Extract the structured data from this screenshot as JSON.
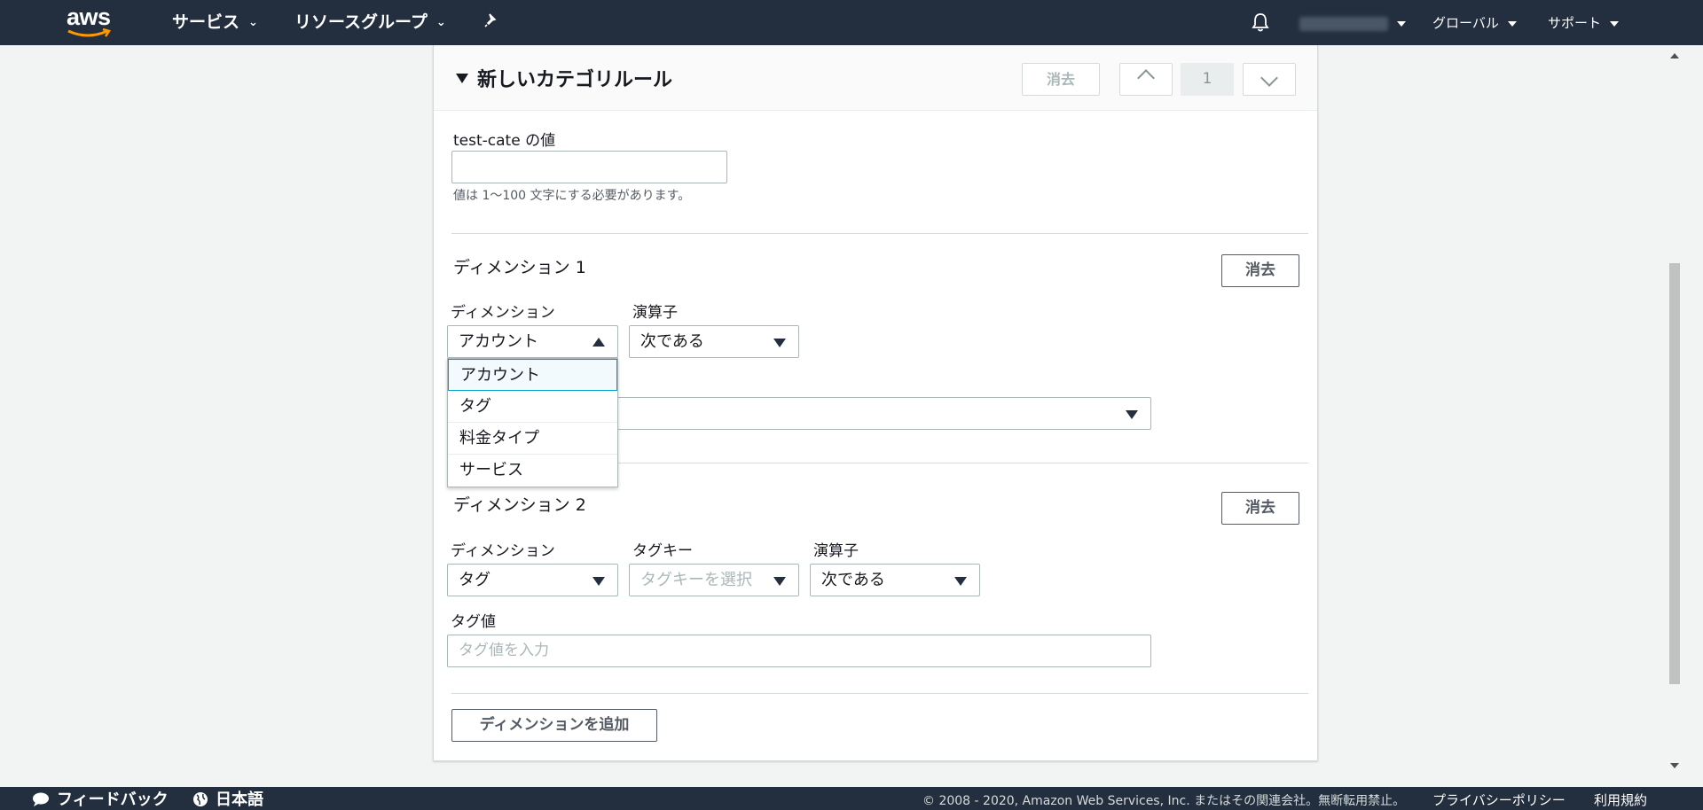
{
  "nav": {
    "logo": "aws",
    "services": "サービス",
    "resource_groups": "リソースグループ",
    "global": "グローバル",
    "support": "サポート"
  },
  "rule": {
    "title": "新しいカテゴリルール",
    "delete_label": "消去",
    "page_number": "1"
  },
  "value_field": {
    "label": "test-cate の値",
    "value": "",
    "hint": "値は 1〜100 文字にする必要があります。"
  },
  "dimension1": {
    "title": "ディメンション 1",
    "delete_label": "消去",
    "dimension_label": "ディメンション",
    "dimension_value": "アカウント",
    "operator_label": "演算子",
    "operator_value": "次である",
    "dropdown_options": [
      "アカウント",
      "タグ",
      "料金タイプ",
      "サービス"
    ]
  },
  "dimension2": {
    "title": "ディメンション 2",
    "delete_label": "消去",
    "dimension_label": "ディメンション",
    "dimension_value": "タグ",
    "tagkey_label": "タグキー",
    "tagkey_placeholder": "タグキーを選択",
    "operator_label": "演算子",
    "operator_value": "次である",
    "tagvalue_label": "タグ値",
    "tagvalue_placeholder": "タグ値を入力"
  },
  "add_dimension_label": "ディメンションを追加",
  "footer": {
    "feedback": "フィードバック",
    "language": "日本語",
    "copyright": "© 2008 - 2020, Amazon Web Services, Inc. またはその関連会社。無断転用禁止。",
    "privacy": "プライバシーポリシー",
    "terms": "利用規約"
  },
  "colors": {
    "nav_bg": "#232f3e",
    "accent": "#00a1c9",
    "aws_orange": "#ff9900"
  },
  "icons": [
    "bell-icon",
    "pin-icon",
    "speech-bubble-icon",
    "globe-icon"
  ]
}
